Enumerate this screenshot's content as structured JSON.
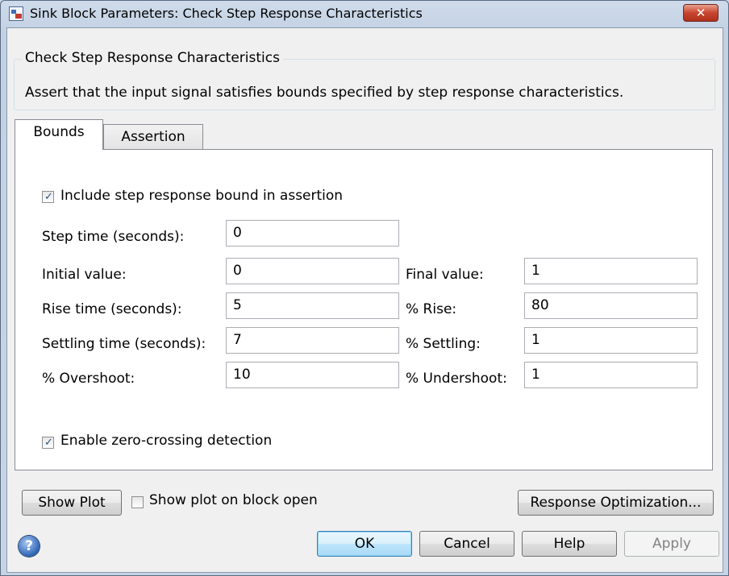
{
  "window": {
    "title": "Sink Block Parameters: Check Step Response Characteristics",
    "close_glyph": "✕"
  },
  "block": {
    "group_title": "Check Step Response Characteristics",
    "description": "Assert that the input signal satisfies bounds specified by step response characteristics."
  },
  "tabs": [
    {
      "label": "Bounds",
      "active": true
    },
    {
      "label": "Assertion",
      "active": false
    }
  ],
  "bounds": {
    "include_bound": {
      "label": "Include step response bound in assertion",
      "checked": true
    },
    "step_time": {
      "label": "Step time (seconds):",
      "value": "0"
    },
    "initial_value": {
      "label": "Initial value:",
      "value": "0"
    },
    "final_value": {
      "label": "Final value:",
      "value": "1"
    },
    "rise_time": {
      "label": "Rise time (seconds):",
      "value": "5"
    },
    "pct_rise": {
      "label": "% Rise:",
      "value": "80"
    },
    "settling_time": {
      "label": "Settling time (seconds):",
      "value": "7"
    },
    "pct_settling": {
      "label": "% Settling:",
      "value": "1"
    },
    "pct_overshoot": {
      "label": "% Overshoot:",
      "value": "10"
    },
    "pct_undershoot": {
      "label": "% Undershoot:",
      "value": "1"
    },
    "zero_crossing": {
      "label": "Enable zero-crossing detection",
      "checked": true
    }
  },
  "plot_row": {
    "show_plot_button": "Show Plot",
    "show_on_open": {
      "label": "Show plot on block open",
      "checked": false
    },
    "response_optimization_button": "Response Optimization..."
  },
  "buttons": {
    "ok": "OK",
    "cancel": "Cancel",
    "help": "Help",
    "apply": "Apply"
  },
  "icons": {
    "help": "?",
    "check": "✓"
  }
}
